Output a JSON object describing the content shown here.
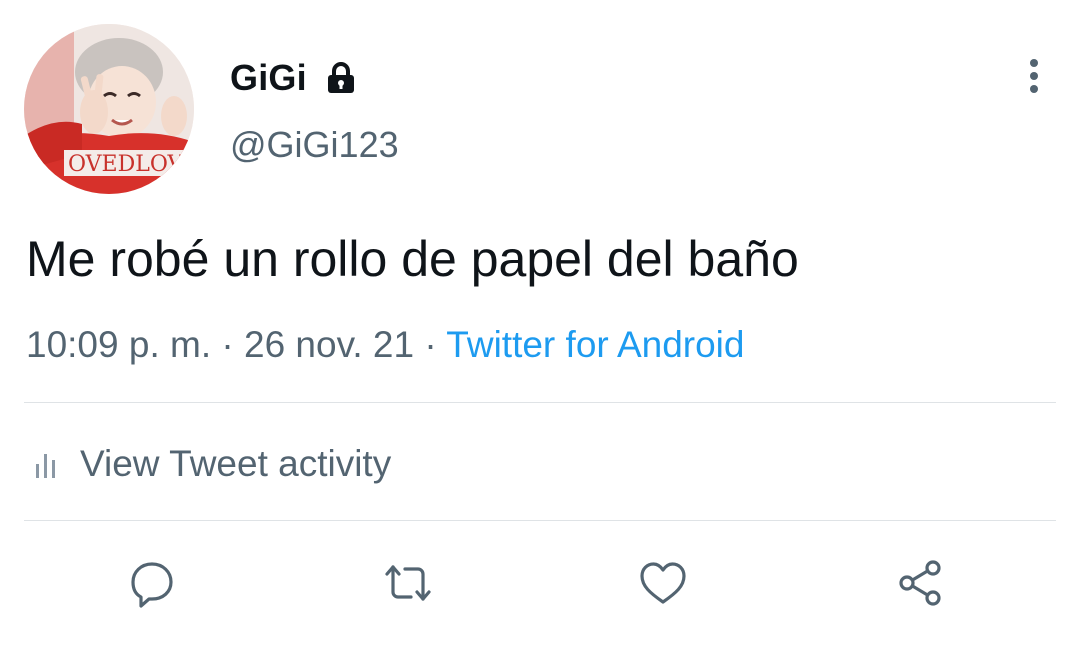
{
  "author": {
    "display_name": "GiGi",
    "handle": "@GiGi123",
    "protected_icon": "lock-icon",
    "avatar_shirt_text": "OVEDLOVE"
  },
  "tweet": {
    "text": "Me robé un rollo de papel del baño",
    "time": "10:09 p. m.",
    "separator": "·",
    "date": "26 nov. 21",
    "source": "Twitter for Android"
  },
  "activity": {
    "icon": "bar-chart-icon",
    "label": "View Tweet activity"
  },
  "actions": [
    {
      "icon": "reply-icon"
    },
    {
      "icon": "retweet-icon"
    },
    {
      "icon": "like-icon"
    },
    {
      "icon": "share-icon"
    }
  ],
  "menu": {
    "icon": "more-vertical-icon"
  },
  "colors": {
    "text_primary": "#0f1419",
    "text_secondary": "#536471",
    "accent": "#1d9bf0",
    "divider": "#dfe3e6"
  }
}
